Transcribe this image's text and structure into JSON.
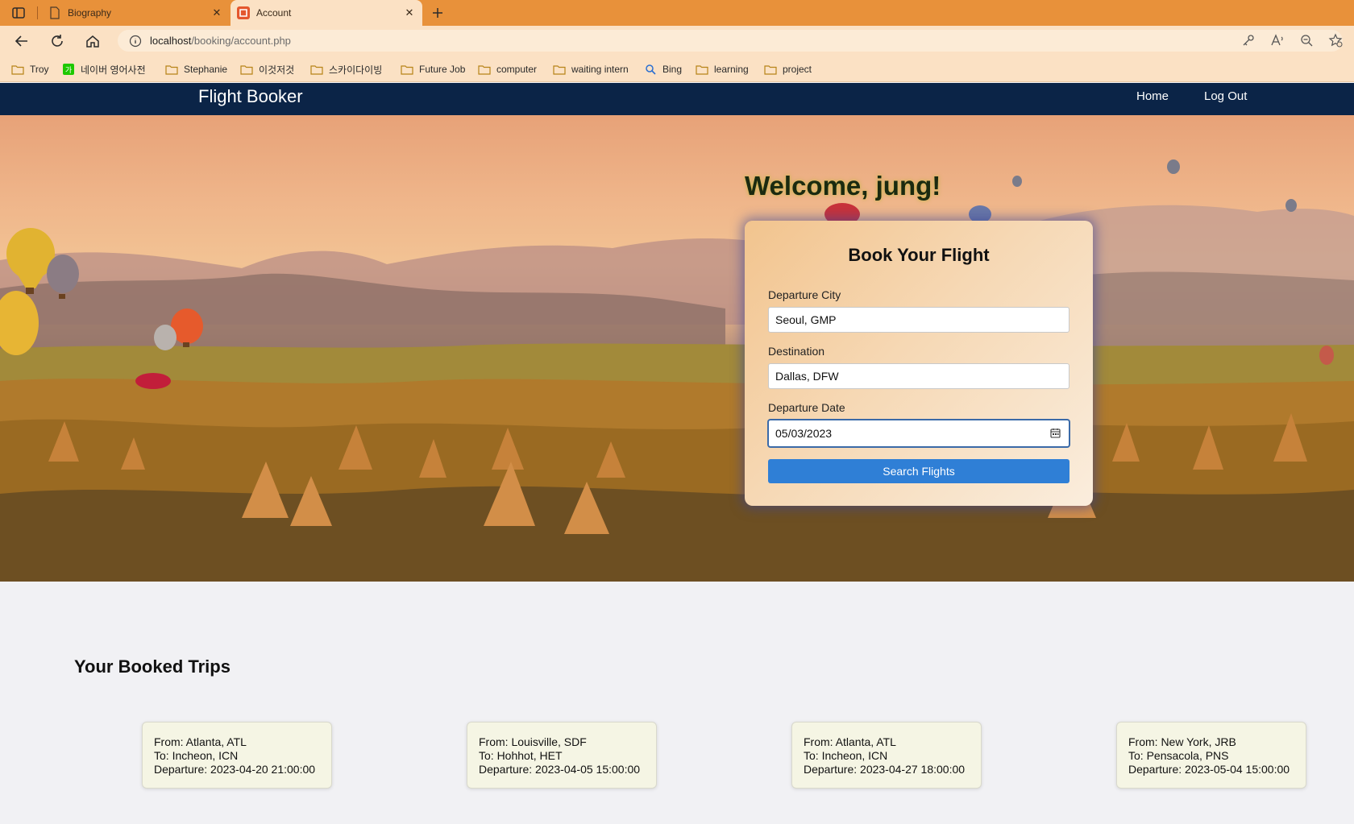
{
  "browser": {
    "tabs": [
      {
        "title": "Biography",
        "active": false
      },
      {
        "title": "Account",
        "active": true
      }
    ],
    "url": {
      "host": "localhost",
      "path": "/booking/account.php"
    },
    "bookmarks": [
      {
        "label": "Troy",
        "icon": "folder-icon"
      },
      {
        "label": "네이버 영어사전",
        "icon": "naver-icon"
      },
      {
        "label": "Stephanie",
        "icon": "folder-icon"
      },
      {
        "label": "이것저것",
        "icon": "folder-icon"
      },
      {
        "label": "스카이다이빙",
        "icon": "folder-icon"
      },
      {
        "label": "Future Job",
        "icon": "folder-icon"
      },
      {
        "label": "computer",
        "icon": "folder-icon"
      },
      {
        "label": "waiting intern",
        "icon": "folder-icon"
      },
      {
        "label": "Bing",
        "icon": "search-icon"
      },
      {
        "label": "learning",
        "icon": "folder-icon"
      },
      {
        "label": "project",
        "icon": "folder-icon"
      }
    ],
    "colors": {
      "tab_bar": "#e8913a",
      "toolbar": "#fbe1c4"
    }
  },
  "site": {
    "brand": "Flight Booker",
    "nav": {
      "home": "Home",
      "logout": "Log Out"
    },
    "colors": {
      "navbar": "#0b2447",
      "button": "#2f7fd6"
    }
  },
  "welcome": "Welcome, jung!",
  "booking": {
    "title": "Book Your Flight",
    "departure_label": "Departure City",
    "departure_value": "Seoul, GMP",
    "destination_label": "Destination",
    "destination_value": "Dallas, DFW",
    "date_label": "Departure Date",
    "date_value": "05/03/2023",
    "submit": "Search Flights"
  },
  "trips": {
    "heading": "Your Booked Trips",
    "items": [
      {
        "from": "From: Atlanta, ATL",
        "to": "To: Incheon, ICN",
        "departure": "Departure: 2023-04-20 21:00:00"
      },
      {
        "from": "From: Louisville, SDF",
        "to": "To: Hohhot, HET",
        "departure": "Departure: 2023-04-05 15:00:00"
      },
      {
        "from": "From: Atlanta, ATL",
        "to": "To: Incheon, ICN",
        "departure": "Departure: 2023-04-27 18:00:00"
      },
      {
        "from": "From: New York, JRB",
        "to": "To: Pensacola, PNS",
        "departure": "Departure: 2023-05-04 15:00:00"
      }
    ]
  }
}
